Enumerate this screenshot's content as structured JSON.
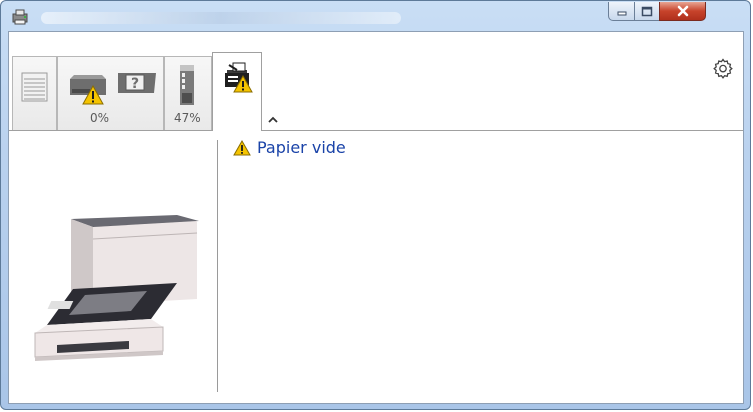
{
  "window": {
    "title": ""
  },
  "tabs": [
    {
      "name": "paper-stack",
      "percent": ""
    },
    {
      "name": "toner",
      "percent": "0%"
    },
    {
      "name": "waste-toner",
      "percent": "47%"
    },
    {
      "name": "printer-status",
      "percent": "",
      "active": true
    }
  ],
  "status": {
    "message": "Papier vide",
    "icon": "warning-icon"
  },
  "colors": {
    "warning": "#f5c400",
    "link": "#1a43a8",
    "close": "#c7432b"
  }
}
